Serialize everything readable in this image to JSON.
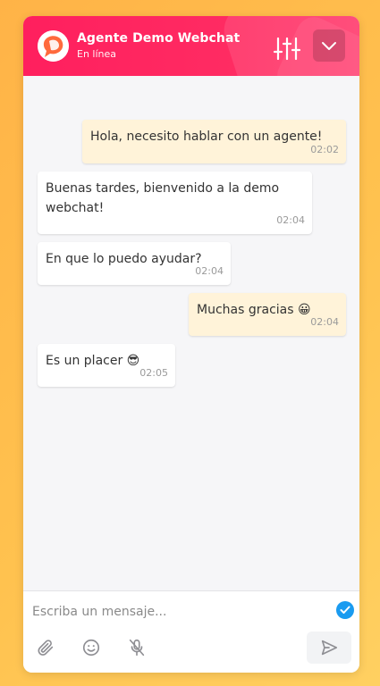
{
  "header": {
    "title": "Agente Demo Webchat",
    "status": "En línea",
    "accent": "#ff1f5e",
    "icons": {
      "logo": "chat-logo-icon",
      "settings": "sliders-icon",
      "collapse": "chevron-down-icon"
    }
  },
  "messages": [
    {
      "direction": "outgoing",
      "text": "Hola, necesito hablar con un agente!",
      "time": "02:02"
    },
    {
      "direction": "incoming",
      "text": "Buenas tardes, bienvenido a la demo webchat!",
      "time": "02:04"
    },
    {
      "direction": "incoming",
      "text": "En que lo puedo ayudar?",
      "time": "02:04"
    },
    {
      "direction": "outgoing",
      "text": "Muchas gracias 😀",
      "time": "02:04"
    },
    {
      "direction": "incoming",
      "text": "Es un placer 😎",
      "time": "02:05"
    }
  ],
  "composer": {
    "placeholder": "Escriba un mensaje...",
    "value": "",
    "icons": [
      "attachment-icon",
      "emoji-icon",
      "microphone-icon",
      "send-icon",
      "check-icon"
    ]
  },
  "colors": {
    "outgoing_bubble": "#fff3d9",
    "incoming_bubble": "#ffffff",
    "check": "#1a9bf0"
  }
}
